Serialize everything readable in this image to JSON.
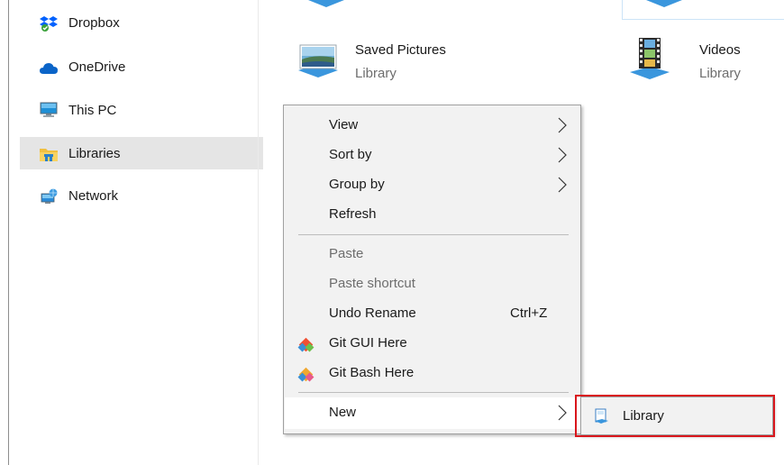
{
  "nav": {
    "items": [
      {
        "label": "Dropbox",
        "icon": "dropbox-icon"
      },
      {
        "label": "OneDrive",
        "icon": "onedrive-cloud-icon"
      },
      {
        "label": "This PC",
        "icon": "computer-monitor-icon"
      },
      {
        "label": "Libraries",
        "icon": "libraries-folder-icon",
        "selected": true
      },
      {
        "label": "Network",
        "icon": "network-icon"
      }
    ]
  },
  "content": {
    "libraries": [
      {
        "name": "Saved Pictures",
        "type": "Library",
        "icon": "pictures-library-icon"
      },
      {
        "name": "Videos",
        "type": "Library",
        "icon": "videos-library-icon"
      }
    ]
  },
  "context_menu": {
    "view": "View",
    "sort_by": "Sort by",
    "group_by": "Group by",
    "refresh": "Refresh",
    "paste": "Paste",
    "paste_shortcut": "Paste shortcut",
    "undo_rename": "Undo Rename",
    "undo_shortcut": "Ctrl+Z",
    "git_gui": "Git GUI Here",
    "git_bash": "Git Bash Here",
    "new": "New"
  },
  "submenu": {
    "library": "Library"
  },
  "colors": {
    "selection": "#e5e5e5",
    "highlight_box": "#d9161c",
    "menu_bg": "#f2f2f2",
    "disabled_text": "#6d6d6d"
  }
}
